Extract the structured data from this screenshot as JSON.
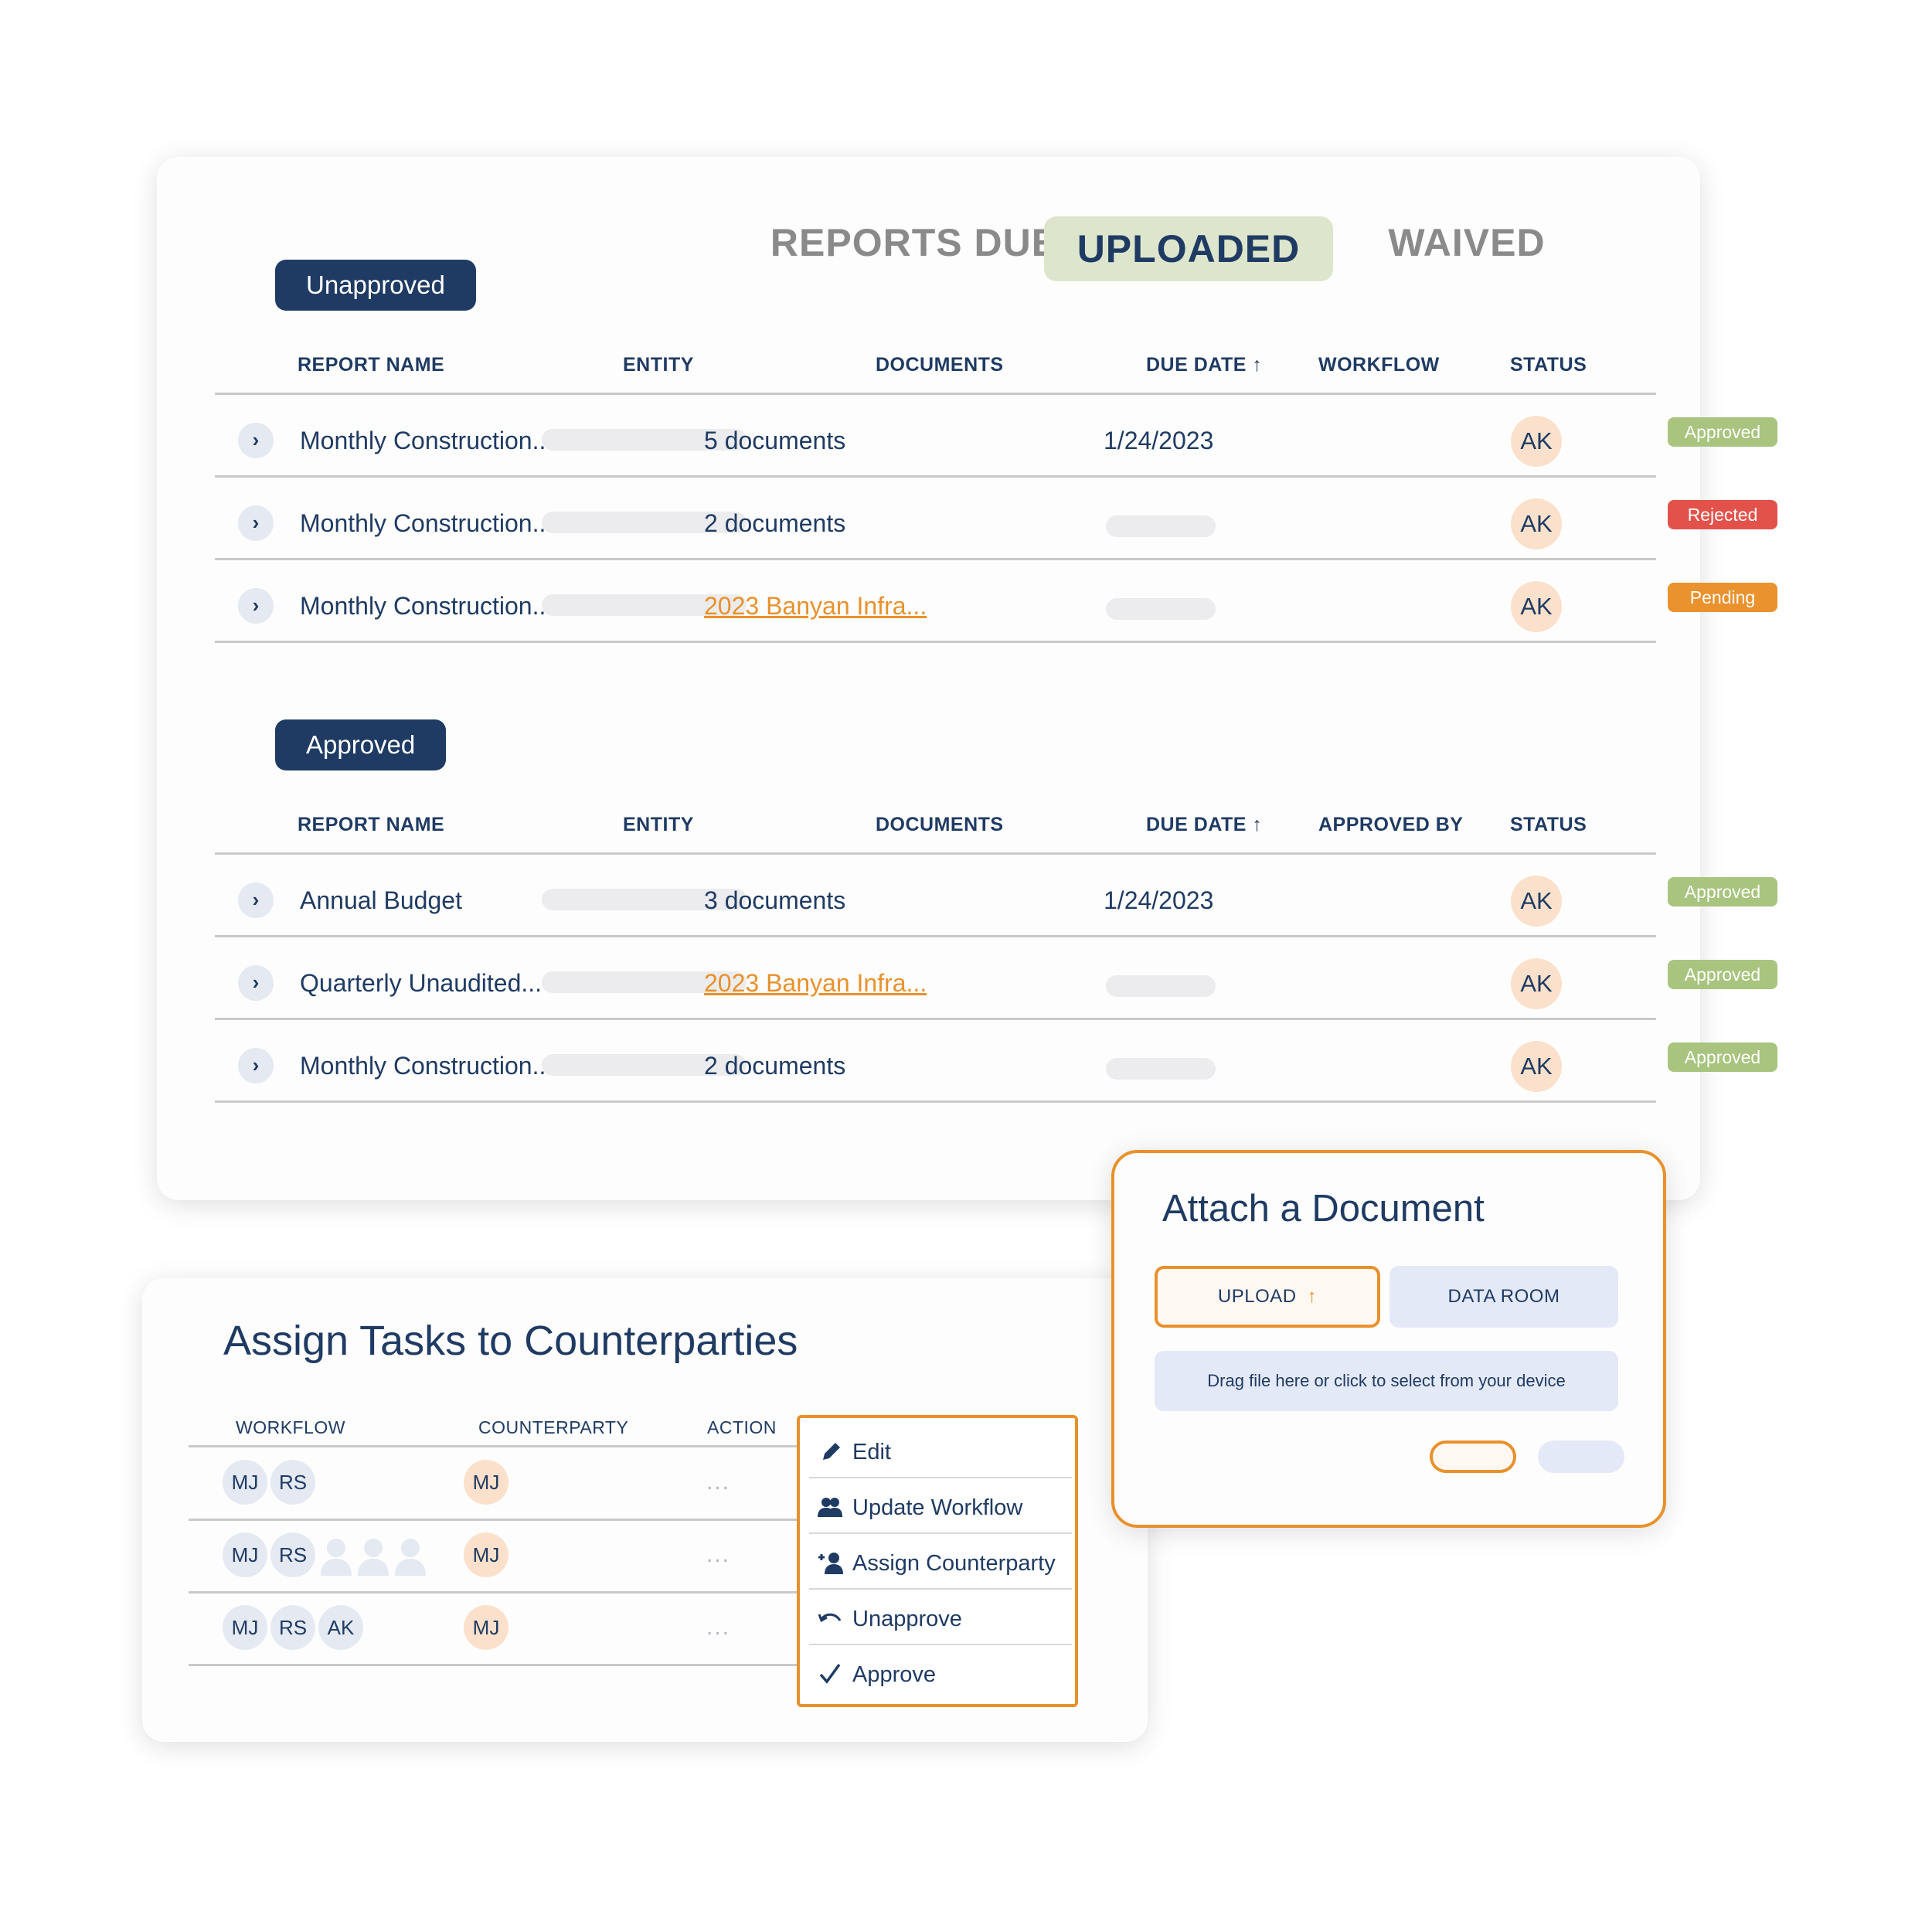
{
  "tabs": {
    "reports_due": "REPORTS DUE",
    "uploaded": "UPLOADED",
    "waived": "WAIVED",
    "active": "UPLOADED"
  },
  "unapproved": {
    "label": "Unapproved",
    "columns": [
      "REPORT NAME",
      "ENTITY",
      "DOCUMENTS",
      "DUE DATE",
      "WORKFLOW",
      "STATUS"
    ],
    "sort_indicator": "↑",
    "rows": [
      {
        "name": "Monthly Construction...",
        "documents": "5 documents",
        "documents_is_link": false,
        "due_date": "1/24/2023",
        "assignee": "AK",
        "status": "Approved"
      },
      {
        "name": "Monthly Construction...",
        "documents": "2 documents",
        "documents_is_link": false,
        "due_date": "",
        "assignee": "AK",
        "status": "Rejected"
      },
      {
        "name": "Monthly Construction...",
        "documents": "2023 Banyan Infra...",
        "documents_is_link": true,
        "due_date": "",
        "assignee": "AK",
        "status": "Pending"
      }
    ]
  },
  "approved": {
    "label": "Approved",
    "columns": [
      "REPORT NAME",
      "ENTITY",
      "DOCUMENTS",
      "DUE DATE",
      "APPROVED BY",
      "STATUS"
    ],
    "sort_indicator": "↑",
    "rows": [
      {
        "name": "Annual Budget",
        "documents": "3 documents",
        "documents_is_link": false,
        "due_date": "1/24/2023",
        "assignee": "AK",
        "status": "Approved"
      },
      {
        "name": "Quarterly Unaudited...",
        "documents": "2023 Banyan Infra...",
        "documents_is_link": true,
        "due_date": "",
        "assignee": "AK",
        "status": "Approved"
      },
      {
        "name": "Monthly Construction...",
        "documents": "2 documents",
        "documents_is_link": false,
        "due_date": "",
        "assignee": "AK",
        "status": "Approved"
      }
    ]
  },
  "status_colors": {
    "Approved": "#a8c47e",
    "Rejected": "#e3524a",
    "Pending": "#ea922e"
  },
  "assign": {
    "title": "Assign Tasks to Counterparties",
    "columns": [
      "WORKFLOW",
      "COUNTERPARTY",
      "ACTION"
    ],
    "rows": [
      {
        "workflow": [
          "MJ",
          "RS"
        ],
        "placeholder_people": 0,
        "counterparty": "MJ",
        "action": "..."
      },
      {
        "workflow": [
          "MJ",
          "RS"
        ],
        "placeholder_people": 3,
        "counterparty": "MJ",
        "action": "..."
      },
      {
        "workflow": [
          "MJ",
          "RS",
          "AK"
        ],
        "placeholder_people": 0,
        "counterparty": "MJ",
        "action": "..."
      }
    ]
  },
  "context_menu": {
    "items": [
      {
        "label": "Edit",
        "icon": "pencil-icon"
      },
      {
        "label": "Update Workflow",
        "icon": "users-icon"
      },
      {
        "label": "Assign Counterparty",
        "icon": "add-user-icon"
      },
      {
        "label": "Unapprove",
        "icon": "undo-icon"
      },
      {
        "label": "Approve",
        "icon": "check-icon"
      }
    ]
  },
  "attach": {
    "title": "Attach a Document",
    "upload_label": "UPLOAD",
    "upload_icon": "↑",
    "dataroom_label": "DATA ROOM",
    "dropzone_text": "Drag file here or click to select from your device"
  },
  "colors": {
    "navy": "#1f3b63",
    "accent_orange": "#e8912c",
    "tab_active_bg": "#dde6cc",
    "avatar_bg": "#fbe1cb",
    "chip_bg": "#e4e9f2"
  }
}
